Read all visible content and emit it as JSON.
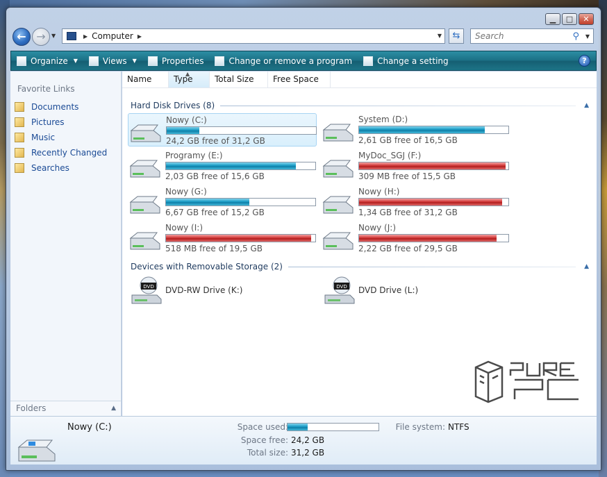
{
  "window": {
    "caption_buttons": {
      "minimize": "▁",
      "maximize": "□",
      "close": "✕"
    }
  },
  "address": {
    "crumb": "Computer",
    "search_placeholder": "Search"
  },
  "toolbar": {
    "organize": "Organize",
    "views": "Views",
    "properties": "Properties",
    "change_program": "Change or remove a program",
    "change_setting": "Change a setting",
    "help": "?"
  },
  "left_pane": {
    "title": "Favorite Links",
    "items": [
      {
        "label": "Documents"
      },
      {
        "label": "Pictures"
      },
      {
        "label": "Music"
      },
      {
        "label": "Recently Changed"
      },
      {
        "label": "Searches"
      }
    ],
    "folders_label": "Folders"
  },
  "columns": [
    "Name",
    "Type",
    "Total Size",
    "Free Space"
  ],
  "groups": {
    "hdd": "Hard Disk Drives (8)",
    "removable": "Devices with Removable Storage (2)"
  },
  "drives": [
    {
      "name": "Nowy (C:)",
      "free": "24,2 GB free of 31,2 GB",
      "used_fraction": 0.22,
      "color": "blue",
      "selected": true
    },
    {
      "name": "System (D:)",
      "free": "2,61 GB free of 16,5 GB",
      "used_fraction": 0.84,
      "color": "blue",
      "selected": false
    },
    {
      "name": "Programy (E:)",
      "free": "2,03 GB free of 15,6 GB",
      "used_fraction": 0.87,
      "color": "blue",
      "selected": false
    },
    {
      "name": "MyDoc_SGJ (F:)",
      "free": "309 MB free of 15,5 GB",
      "used_fraction": 0.98,
      "color": "red",
      "selected": false
    },
    {
      "name": "Nowy (G:)",
      "free": "6,67 GB free of 15,2 GB",
      "used_fraction": 0.56,
      "color": "blue",
      "selected": false
    },
    {
      "name": "Nowy (H:)",
      "free": "1,34 GB free of 31,2 GB",
      "used_fraction": 0.96,
      "color": "red",
      "selected": false
    },
    {
      "name": "Nowy (I:)",
      "free": "518 MB free of 19,5 GB",
      "used_fraction": 0.97,
      "color": "red",
      "selected": false
    },
    {
      "name": "Nowy (J:)",
      "free": "2,22 GB free of 29,5 GB",
      "used_fraction": 0.92,
      "color": "red",
      "selected": false
    }
  ],
  "removable": [
    {
      "name": "DVD-RW Drive (K:)",
      "badge": "DVD"
    },
    {
      "name": "DVD Drive (L:)",
      "badge": "DVD"
    }
  ],
  "details": {
    "name": "Nowy (C:)",
    "space_used_label": "Space used:",
    "space_used_fraction": 0.22,
    "space_free_label": "Space free:",
    "space_free": "24,2 GB",
    "total_size_label": "Total size:",
    "total_size": "31,2 GB",
    "fs_label": "File system:",
    "fs": "NTFS"
  },
  "watermark": "PURE PC",
  "colors": {
    "toolbar": "#1b6f84",
    "link": "#1a4a95",
    "bar_ok": "#1a9cc6",
    "bar_full": "#d23a3a"
  }
}
